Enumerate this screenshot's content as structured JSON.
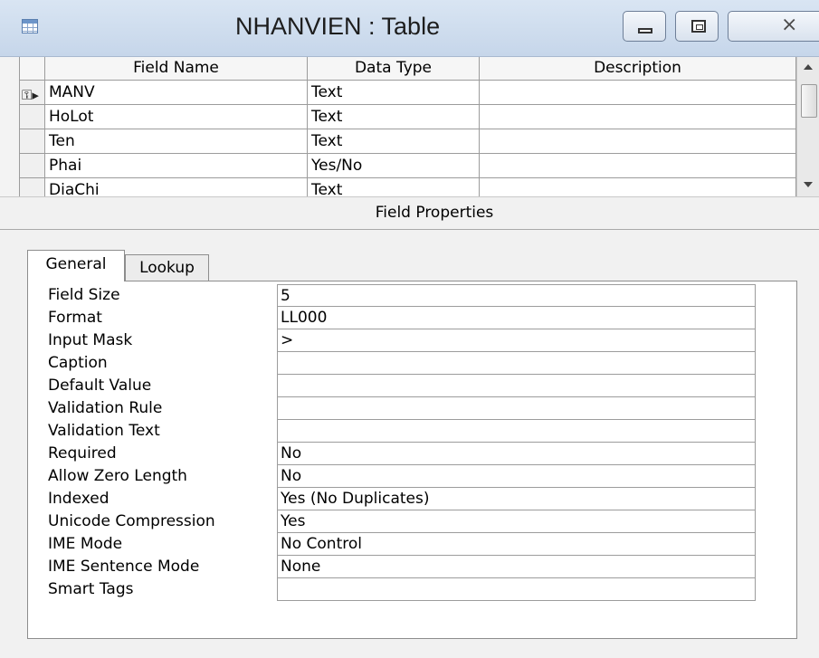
{
  "window": {
    "title": "NHANVIEN : Table"
  },
  "grid": {
    "headers": {
      "field_name": "Field Name",
      "data_type": "Data Type",
      "description": "Description"
    },
    "rows": [
      {
        "field": "MANV",
        "type": "Text",
        "description": "",
        "primary_key": true,
        "current": true
      },
      {
        "field": "HoLot",
        "type": "Text",
        "description": ""
      },
      {
        "field": "Ten",
        "type": "Text",
        "description": ""
      },
      {
        "field": "Phai",
        "type": "Yes/No",
        "description": ""
      },
      {
        "field": "DiaChi",
        "type": "Text",
        "description": ""
      }
    ]
  },
  "field_properties": {
    "title": "Field Properties",
    "tabs": [
      {
        "label": "General",
        "active": true
      },
      {
        "label": "Lookup",
        "active": false
      }
    ],
    "properties": [
      {
        "label": "Field Size",
        "value": "5"
      },
      {
        "label": "Format",
        "value": "LL000"
      },
      {
        "label": "Input Mask",
        "value": ">"
      },
      {
        "label": "Caption",
        "value": ""
      },
      {
        "label": "Default Value",
        "value": ""
      },
      {
        "label": "Validation Rule",
        "value": ""
      },
      {
        "label": "Validation Text",
        "value": ""
      },
      {
        "label": "Required",
        "value": "No"
      },
      {
        "label": "Allow Zero Length",
        "value": "No"
      },
      {
        "label": "Indexed",
        "value": "Yes (No Duplicates)"
      },
      {
        "label": "Unicode Compression",
        "value": "Yes"
      },
      {
        "label": "IME Mode",
        "value": "No Control"
      },
      {
        "label": "IME Sentence Mode",
        "value": "None"
      },
      {
        "label": "Smart Tags",
        "value": ""
      }
    ]
  },
  "icons": [
    "table-icon",
    "minimize-icon",
    "maximize-icon",
    "close-icon",
    "primary-key-icon",
    "scroll-up-icon",
    "scroll-down-icon"
  ]
}
